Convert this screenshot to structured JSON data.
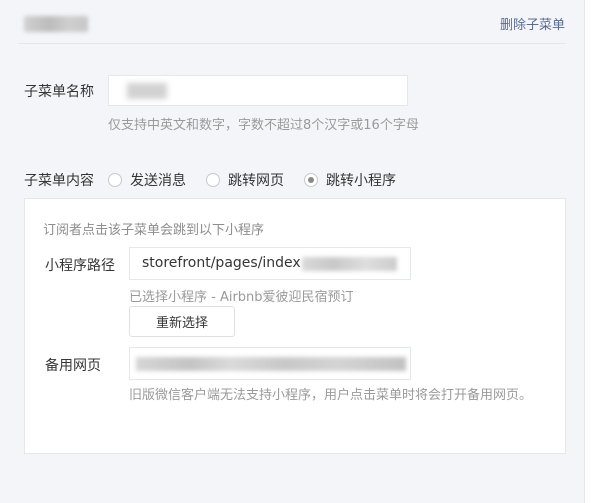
{
  "header": {
    "delete_label": "删除子菜单"
  },
  "menu_name": {
    "label": "子菜单名称",
    "value": "",
    "hint": "仅支持中英文和数字，字数不超过8个汉字或16个字母"
  },
  "menu_content": {
    "label": "子菜单内容",
    "options": [
      {
        "label": "发送消息",
        "checked": false
      },
      {
        "label": "跳转网页",
        "checked": false
      },
      {
        "label": "跳转小程序",
        "checked": true
      }
    ]
  },
  "miniprogram": {
    "description": "订阅者点击该子菜单会跳到以下小程序",
    "path_label": "小程序路径",
    "path_value": "storefront/pages/index",
    "selected_text": "已选择小程序 - Airbnb爱彼迎民宿预订",
    "reselect_label": "重新选择",
    "backup_label": "备用网页",
    "backup_note": "旧版微信客户端无法支持小程序，用户点击菜单时将会打开备用网页。"
  }
}
